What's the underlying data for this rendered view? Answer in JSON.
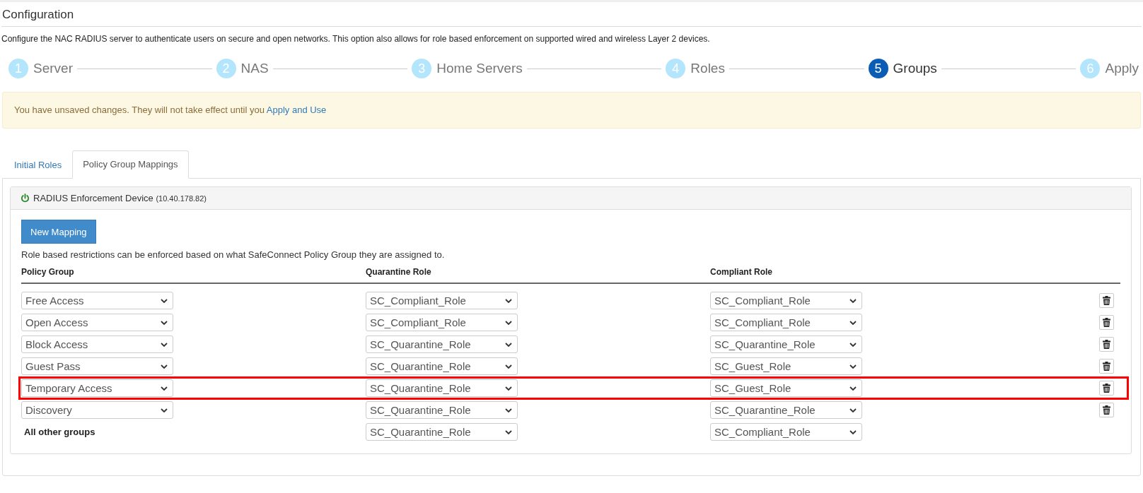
{
  "page": {
    "title": "Configuration",
    "description": "Configure the NAC RADIUS server to authenticate users on secure and open networks. This option also allows for role based enforcement on supported wired and wireless Layer 2 devices."
  },
  "steps": [
    {
      "number": "1",
      "label": "Server",
      "selected": false
    },
    {
      "number": "2",
      "label": "NAS",
      "selected": false
    },
    {
      "number": "3",
      "label": "Home Servers",
      "selected": false
    },
    {
      "number": "4",
      "label": "Roles",
      "selected": false
    },
    {
      "number": "5",
      "label": "Groups",
      "selected": true
    },
    {
      "number": "6",
      "label": "Apply",
      "selected": false
    }
  ],
  "alert": {
    "text": "You have unsaved changes. They will not take effect until you",
    "link": "Apply and Use"
  },
  "tabs": [
    {
      "label": "Initial Roles",
      "selected": false
    },
    {
      "label": "Policy Group Mappings",
      "selected": true
    }
  ],
  "device": {
    "name": "RADIUS Enforcement Device",
    "address": "(10.40.178.82)",
    "on": true
  },
  "new_mapping_button": "New Mapping",
  "help_text": "Role based restrictions can be enforced based on what SafeConnect Policy Group they are assigned to.",
  "table": {
    "columns": [
      "Policy Group",
      "Quarantine Role",
      "Compliant Role"
    ],
    "rows": [
      {
        "kind": "select",
        "policy_group": "Free Access",
        "quarantine_role": "SC_Compliant_Role",
        "compliant_role": "SC_Compliant_Role",
        "deletable": true,
        "highlighted": false
      },
      {
        "kind": "select",
        "policy_group": "Open Access",
        "quarantine_role": "SC_Compliant_Role",
        "compliant_role": "SC_Compliant_Role",
        "deletable": true,
        "highlighted": false
      },
      {
        "kind": "select",
        "policy_group": "Block Access",
        "quarantine_role": "SC_Quarantine_Role",
        "compliant_role": "SC_Quarantine_Role",
        "deletable": true,
        "highlighted": false
      },
      {
        "kind": "select",
        "policy_group": "Guest Pass",
        "quarantine_role": "SC_Quarantine_Role",
        "compliant_role": "SC_Guest_Role",
        "deletable": true,
        "highlighted": false
      },
      {
        "kind": "select",
        "policy_group": "Temporary Access",
        "quarantine_role": "SC_Quarantine_Role",
        "compliant_role": "SC_Guest_Role",
        "deletable": true,
        "highlighted": true
      },
      {
        "kind": "select",
        "policy_group": "Discovery",
        "quarantine_role": "SC_Quarantine_Role",
        "compliant_role": "SC_Quarantine_Role",
        "deletable": true,
        "highlighted": false
      },
      {
        "kind": "label",
        "policy_group": "All other groups",
        "quarantine_role": "SC_Quarantine_Role",
        "compliant_role": "SC_Compliant_Role",
        "deletable": false,
        "highlighted": false
      }
    ]
  }
}
